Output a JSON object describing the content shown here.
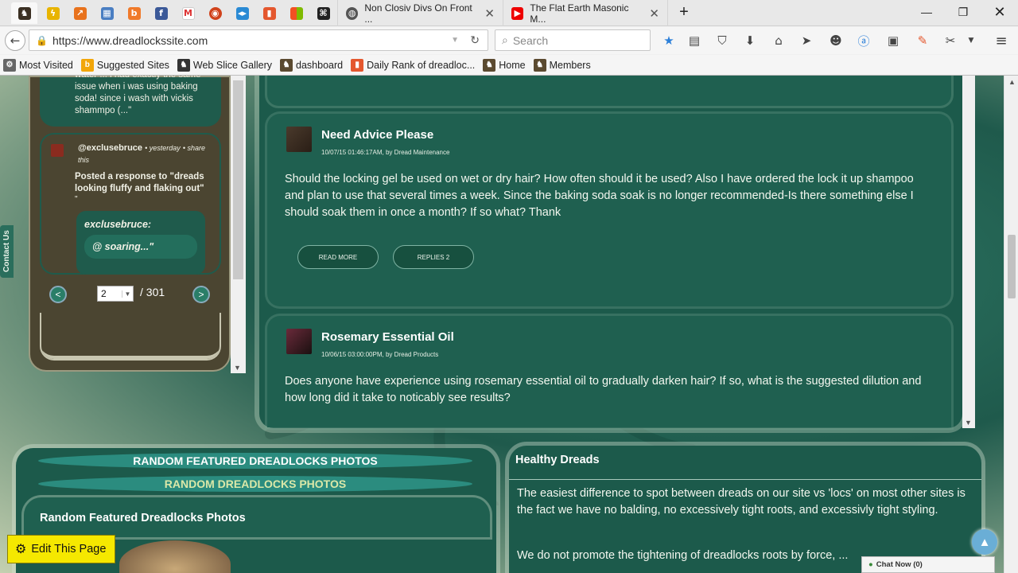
{
  "browser": {
    "tabs": [
      {
        "title": "Non Closiv Divs On Front ..."
      },
      {
        "title": "The Flat Earth Masonic M..."
      }
    ],
    "new_tab_symbol": "+",
    "url": "https://www.dreadlockssite.com",
    "search_placeholder": "Search",
    "bookmarks": [
      {
        "label": "Most Visited",
        "icon": "gear-icon"
      },
      {
        "label": "Suggested Sites",
        "icon": "suggested-icon"
      },
      {
        "label": "Web Slice Gallery",
        "icon": "web-slice-icon"
      },
      {
        "label": "dashboard",
        "icon": "site-icon"
      },
      {
        "label": "Daily Rank of dreadloc...",
        "icon": "rank-icon"
      },
      {
        "label": "Home",
        "icon": "site-icon"
      },
      {
        "label": "Members",
        "icon": "site-icon"
      }
    ]
  },
  "sidebar": {
    "prev_comment_text": "water ... i had exactly the same issue  when i was using baking soda!  since i wash with vickis shammpo (...\"",
    "activity": {
      "user": "@exclusebruce",
      "time": "yesterday",
      "share": "share this",
      "action": "Posted a response to \"dreads looking fluffy and flaking out\"",
      "quote_open": "\"",
      "quote_user": "exclusebruce:",
      "quote_text": "@ soaring...\""
    },
    "pager": {
      "prev": "<",
      "next": ">",
      "page": "2",
      "total": "/ 301"
    },
    "contact_label": "Contact Us"
  },
  "feed": {
    "posts": [
      {
        "title": "Need Advice Please",
        "date": "10/07/15 01:46:17AM, by ",
        "category": "Dread Maintenance",
        "body": "Should the locking gel be used on wet or dry hair? How often should it be used?  Also I have ordered the lock it up shampoo and plan to use that several times a week.  Since the baking soda soak is no longer recommended-Is there something else I should soak them in once a month? If so what? Thank",
        "read_more": "READ MORE",
        "replies": "REPLIES 2"
      },
      {
        "title": "Rosemary Essential Oil",
        "date": "10/06/15 03:00:00PM, by ",
        "category": "Dread Products",
        "body": "Does anyone have experience using rosemary essential oil to gradually darken hair?  If so, what is the suggested dilution and how long did it take to noticably see results?"
      }
    ]
  },
  "photos": {
    "band1": "RANDOM FEATURED DREADLOCKS PHOTOS",
    "band2": "RANDOM DREADLOCKS PHOTOS",
    "heading": "Random Featured Dreadlocks Photos"
  },
  "healthy": {
    "heading": "Healthy Dreads",
    "p1": "The easiest difference to spot between dreads on our site vs 'locs' on most other sites is the fact we have no balding, no excessively tight roots, and excessivly tight styling.",
    "p2": "We do not promote the tightening of dreadlocks roots by force, ..."
  },
  "widgets": {
    "edit_page": "Edit This Page",
    "chat": "Chat Now (0)",
    "up_arrow": "▲"
  }
}
